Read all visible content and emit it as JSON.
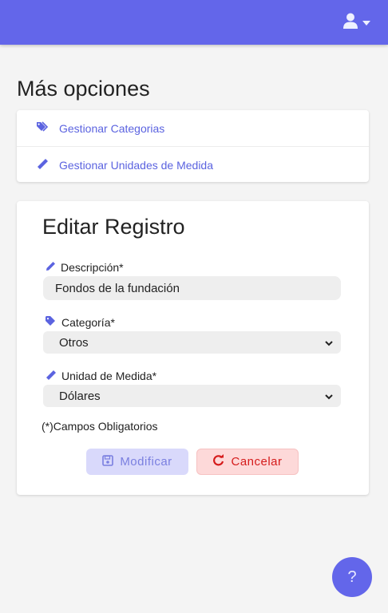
{
  "header": {
    "user_icon": "user-icon",
    "caret_icon": "caret-down-icon",
    "accent_color": "#6366ea"
  },
  "more_options": {
    "title": "Más opciones",
    "items": [
      {
        "label": "Gestionar Categorias",
        "icon": "tags-icon"
      },
      {
        "label": "Gestionar Unidades de Medida",
        "icon": "ruler-icon"
      }
    ]
  },
  "form": {
    "title": "Editar Registro",
    "description_label": "Descripción*",
    "description_icon": "pencil-icon",
    "description_value": "Fondos de la fundación",
    "category_label": "Categoría*",
    "category_icon": "tag-icon",
    "category_value": "Otros",
    "unit_label": "Unidad de Medida*",
    "unit_icon": "ruler-icon",
    "unit_value": "Dólares",
    "required_note": "(*)Campos Obligatorios",
    "save_label": "Modificar",
    "save_icon": "save-icon",
    "cancel_label": "Cancelar",
    "cancel_icon": "redo-icon"
  },
  "help": {
    "label": "?"
  }
}
